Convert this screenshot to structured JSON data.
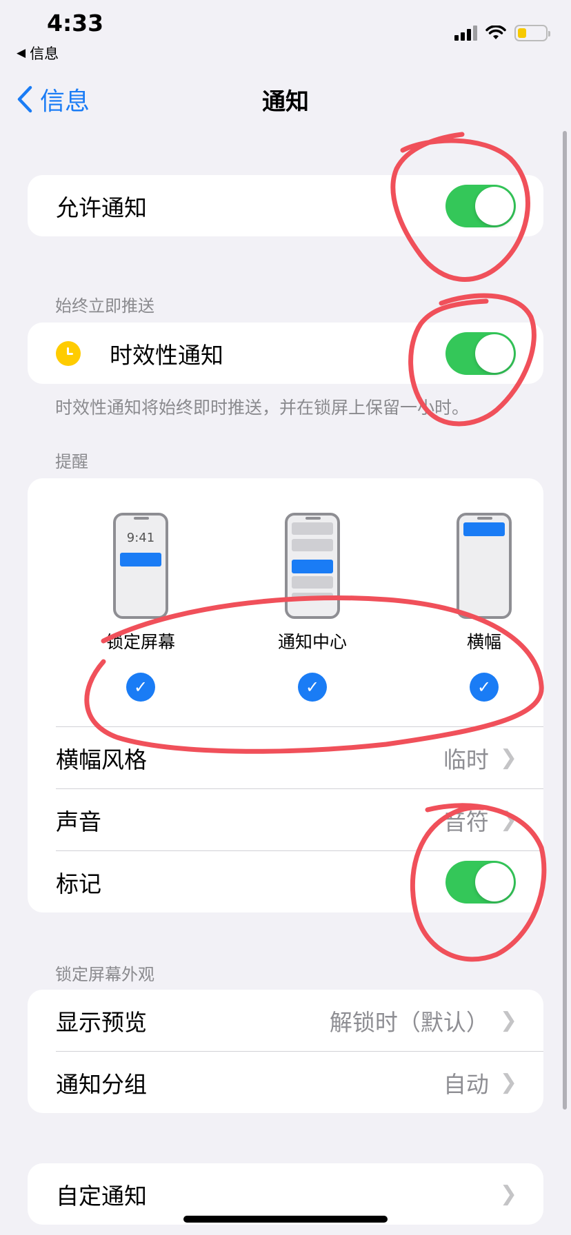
{
  "status": {
    "time": "4:33",
    "back_app": "信息"
  },
  "nav": {
    "back_label": "信息",
    "title": "通知"
  },
  "allow_notifications": {
    "label": "允许通知",
    "enabled": true
  },
  "immediate_section": {
    "header": "始终立即推送",
    "time_sensitive_label": "时效性通知",
    "time_sensitive_enabled": true,
    "footer": "时效性通知将始终即时推送，并在锁屏上保留一小时。"
  },
  "alerts_section": {
    "header": "提醒",
    "styles": [
      {
        "label": "锁定屏幕",
        "preview_time": "9:41",
        "checked": true
      },
      {
        "label": "通知中心",
        "checked": true
      },
      {
        "label": "横幅",
        "checked": true
      }
    ],
    "banner_style": {
      "label": "横幅风格",
      "value": "临时"
    },
    "sounds": {
      "label": "声音",
      "value": "音符"
    },
    "badges": {
      "label": "标记",
      "enabled": true
    }
  },
  "lock_screen_section": {
    "header": "锁定屏幕外观",
    "show_previews": {
      "label": "显示预览",
      "value": "解锁时（默认）"
    },
    "grouping": {
      "label": "通知分组",
      "value": "自动"
    }
  },
  "custom": {
    "label": "自定通知"
  },
  "colors": {
    "accent": "#1a7cf5",
    "toggle_on": "#34c759",
    "annotation": "#f0505a"
  }
}
